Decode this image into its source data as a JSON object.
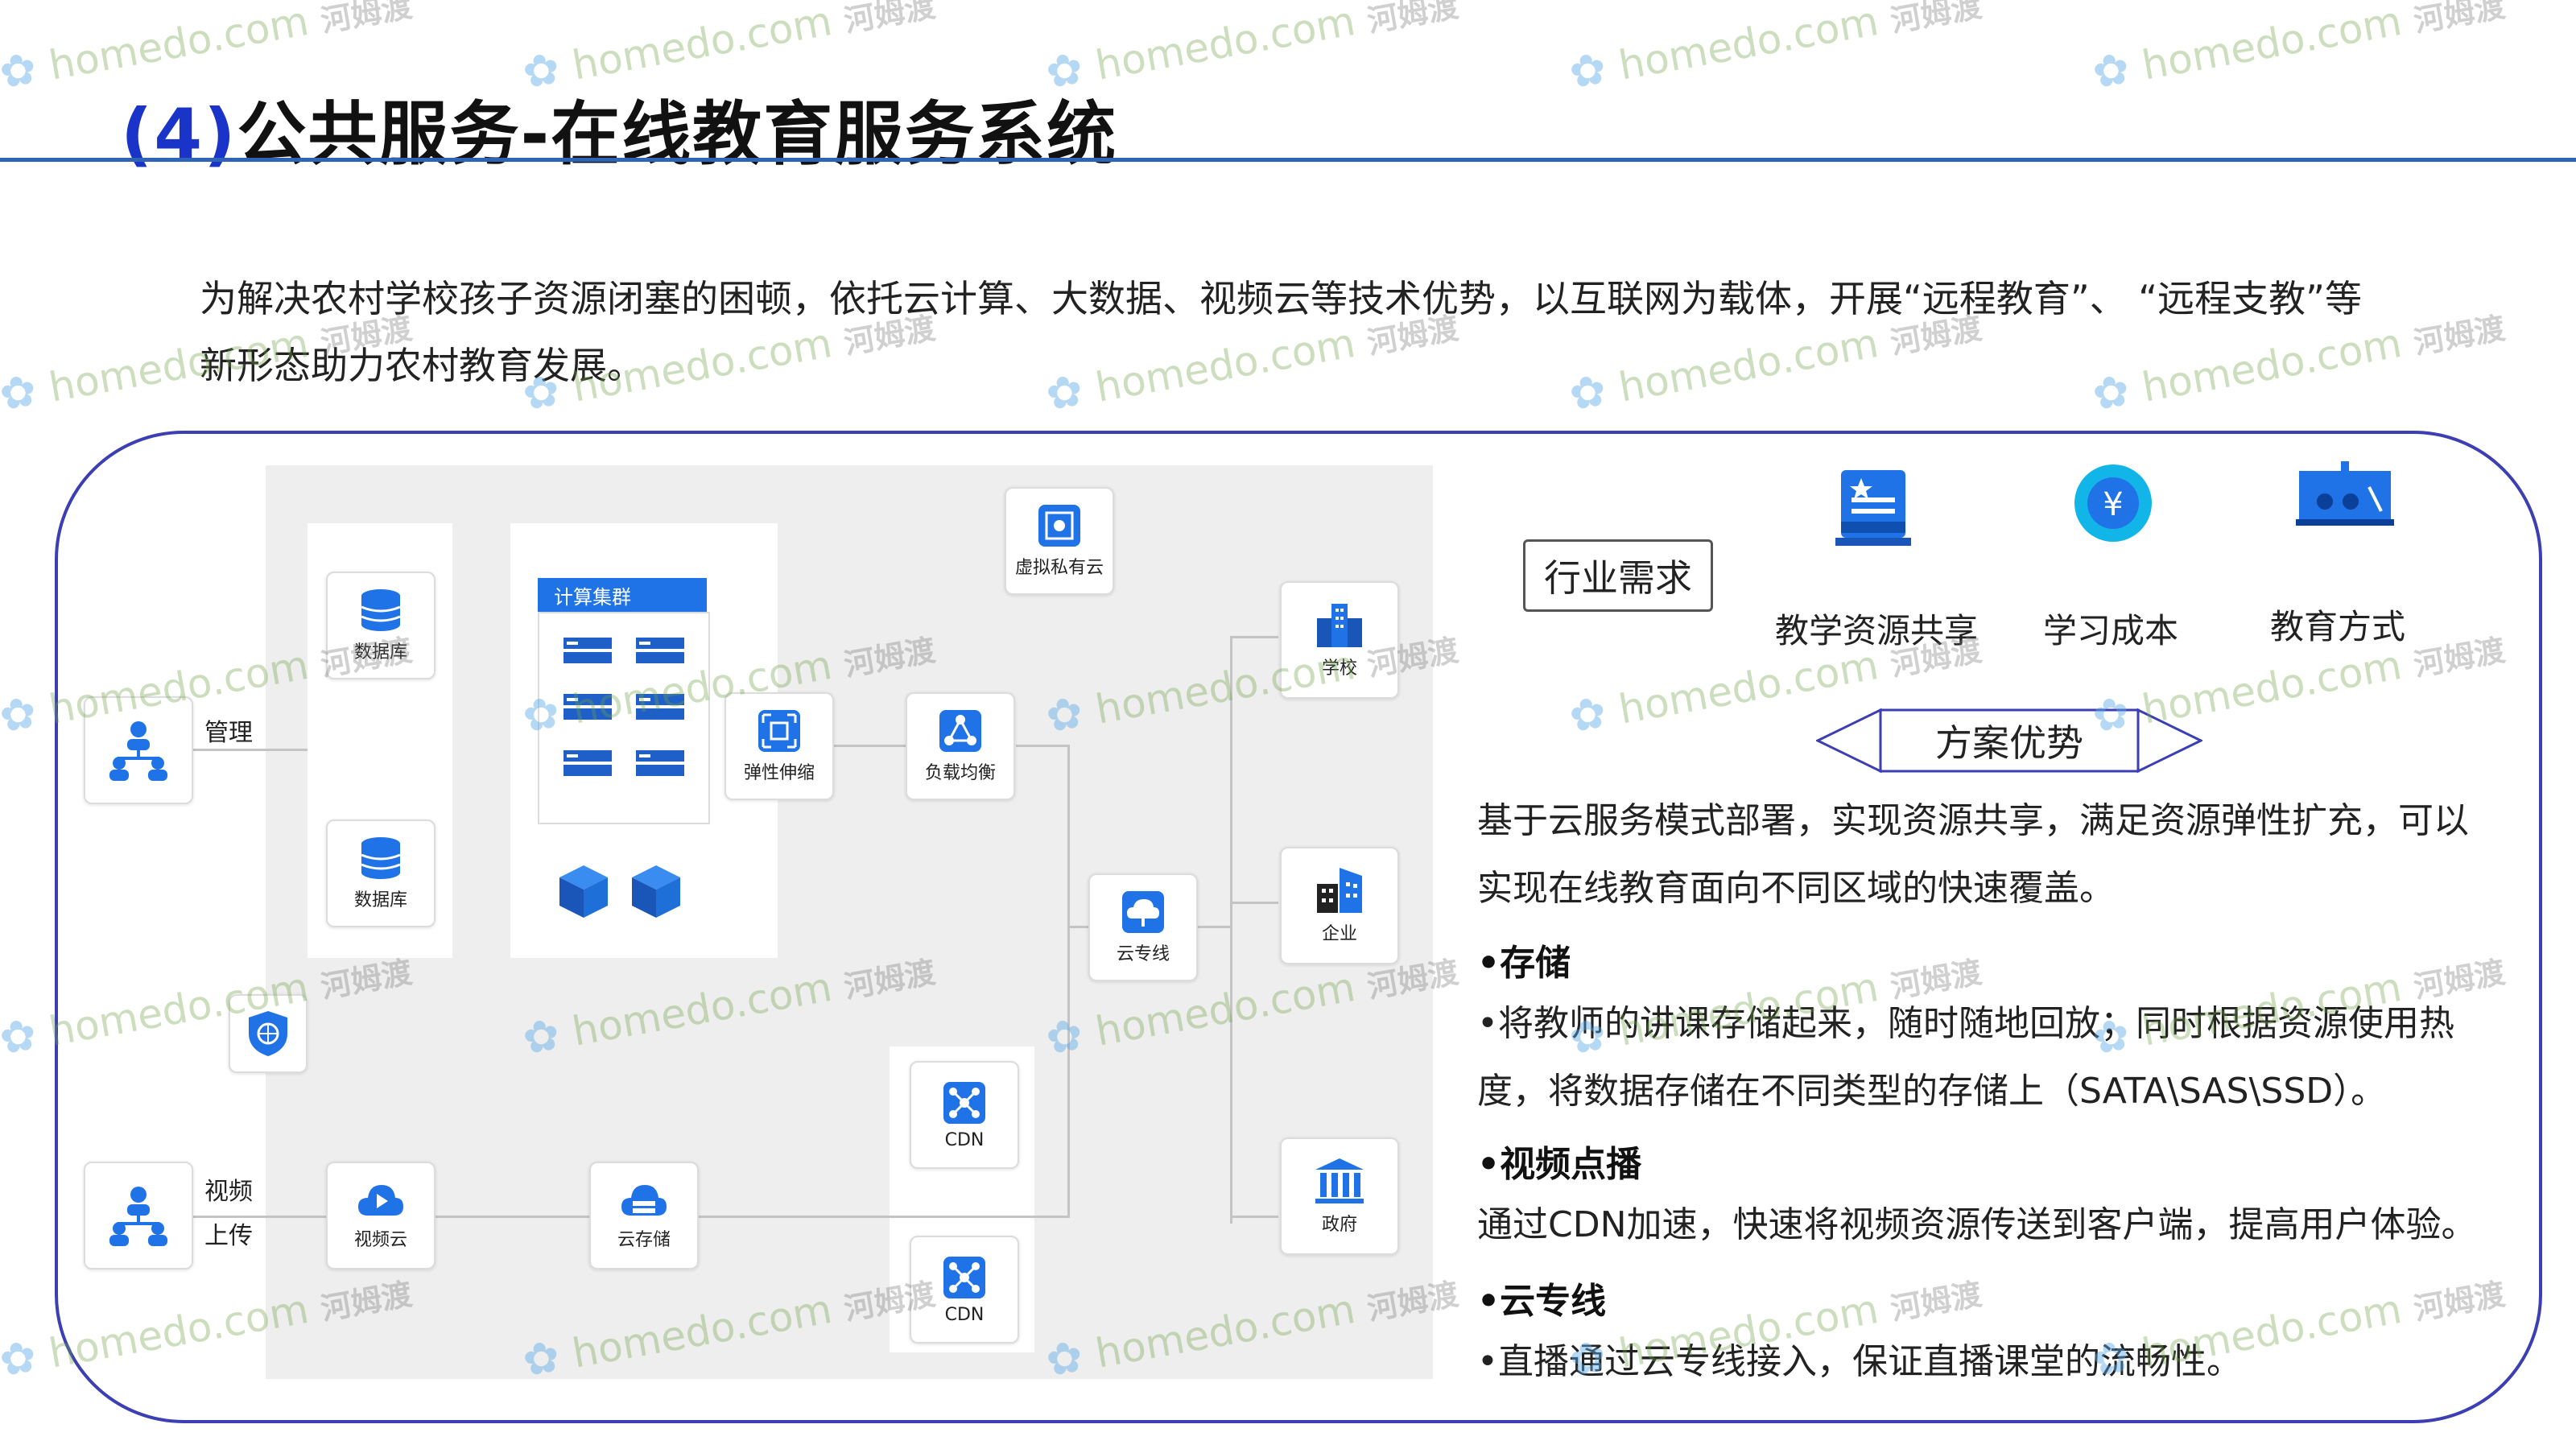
{
  "title": {
    "num": "(4)",
    "text": "公共服务-在线教育服务系统"
  },
  "intro": "为解决农村学校孩子资源闭塞的困顿，依托云计算、大数据、视频云等技术优势，以互联网为载体，开展“远程教育”、 “远程支教”等新形态助力农村教育发展。",
  "diagram": {
    "manage_label": "管理",
    "upload_label_1": "视频",
    "upload_label_2": "上传",
    "db1": "数据库",
    "db2": "数据库",
    "cluster": "计算集群",
    "elastic": "弹性伸缩",
    "lb": "负载均衡",
    "vpc": "虚拟私有云",
    "dedicated": "云专线",
    "video_cloud": "视频云",
    "cloud_storage": "云存储",
    "cdn1": "CDN",
    "cdn2": "CDN",
    "school": "学校",
    "enterprise": "企业",
    "government": "政府"
  },
  "right": {
    "industry_needs": "行业需求",
    "needs": [
      {
        "label": "教学资源共享",
        "icon": "book-icon"
      },
      {
        "label": "学习成本",
        "icon": "yuan-coin-icon"
      },
      {
        "label": "教育方式",
        "icon": "classroom-icon"
      }
    ],
    "advantages": "方案优势",
    "summary": "基于云服务模式部署，实现资源共享，满足资源弹性扩充，可以实现在线教育面向不同区域的快速覆盖。",
    "storage_head": "•存储",
    "storage_body": "•将教师的讲课存储起来，随时随地回放；同时根据资源使用热度，将数据存储在不同类型的存储上（SATA\\SAS\\SSD）。",
    "vod_head": "•视频点播",
    "vod_body": "通过CDN加速，快速将视频资源传送到客户端，提高用户体验。",
    "line_head": "•云专线",
    "line_body": "•直播通过云专线接入，保证直播课堂的流畅性。"
  },
  "watermark": {
    "site": "homedo.com",
    "cn": "河姆渡"
  },
  "colors": {
    "title_num": "#1a33c8",
    "rule": "#2f63b8",
    "frame": "#3b3fb3",
    "icon_blue": "#1f73e6"
  }
}
